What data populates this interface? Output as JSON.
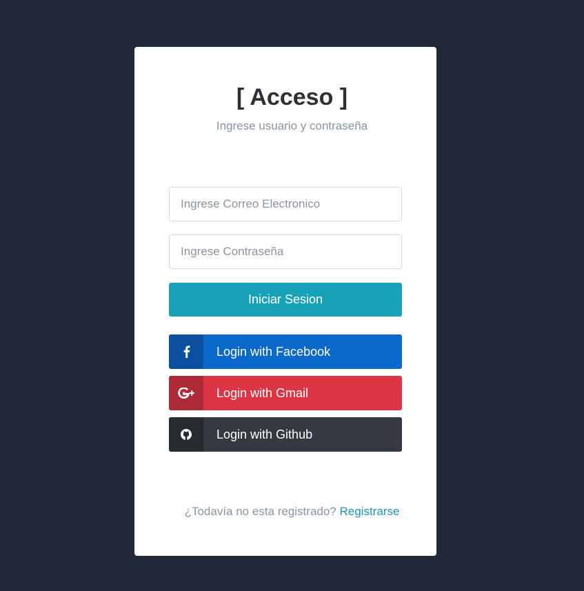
{
  "login": {
    "title": "[ Acceso ]",
    "subtitle": "Ingrese usuario y contraseña",
    "email_placeholder": "Ingrese Correo Electronico",
    "password_placeholder": "Ingrese Contraseña",
    "submit_label": "Iniciar Sesion"
  },
  "social": {
    "facebook_label": "Login with Facebook",
    "gmail_label": "Login with Gmail",
    "github_label": "Login with Github"
  },
  "footer": {
    "prompt": "¿Todavía no esta registrado?",
    "register_link": "Registrarse"
  },
  "icons": {
    "facebook": "facebook-icon",
    "gmail": "google-plus-icon",
    "github": "github-icon"
  },
  "colors": {
    "background": "#1f2937",
    "primary": "#17a2b8",
    "facebook": "#0b69cc",
    "gmail": "#dc3545",
    "github": "#353a40",
    "link": "#1e95b4"
  }
}
